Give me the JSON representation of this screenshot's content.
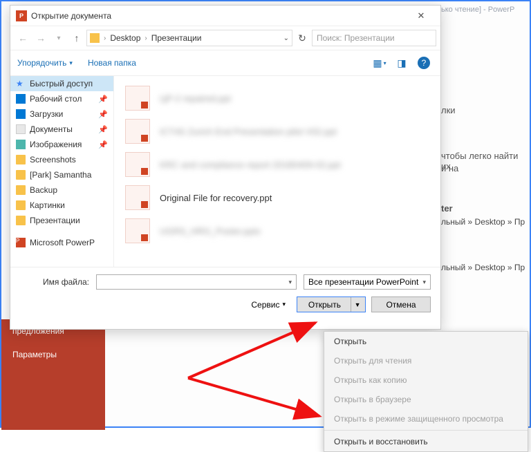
{
  "app_background": {
    "title_fragment": "ько чтение]  -  PowerP",
    "left_menu": {
      "item1": "предложения",
      "item2": "Параметры"
    },
    "right_lines": {
      "l1": "лки",
      "l2": "чтобы легко найти их",
      "l3": "и на",
      "l4": "ter"
    },
    "path_line": "льный » Desktop » Пр"
  },
  "dialog": {
    "title": "Открытие документа",
    "breadcrumb": {
      "seg1": "Desktop",
      "seg2": "Презентации"
    },
    "search_placeholder": "Поиск: Презентации",
    "toolbar": {
      "organize": "Упорядочить",
      "new_folder": "Новая папка"
    },
    "tree": [
      {
        "name": "Быстрый доступ",
        "kind": "star",
        "selected": true
      },
      {
        "name": "Рабочий стол",
        "kind": "desktop",
        "pinned": true
      },
      {
        "name": "Загрузки",
        "kind": "down",
        "pinned": true
      },
      {
        "name": "Документы",
        "kind": "doc",
        "pinned": true
      },
      {
        "name": "Изображения",
        "kind": "img",
        "pinned": true
      },
      {
        "name": "Screenshots",
        "kind": "folder"
      },
      {
        "name": "[Park] Samantha",
        "kind": "folder"
      },
      {
        "name": "Backup",
        "kind": "folder"
      },
      {
        "name": "Картинки",
        "kind": "folder"
      },
      {
        "name": "Презентации",
        "kind": "folder"
      },
      {
        "name": "Microsoft PowerP",
        "kind": "pp"
      }
    ],
    "files": [
      {
        "name": "ЦР-2 repaired.ppt",
        "blur": true
      },
      {
        "name": "ICT4S Zurich End Presentation pilot V02.ppt",
        "blur": true
      },
      {
        "name": "KRC and compliance report 20180409-02.ppt",
        "blur": true
      },
      {
        "name": "Original File for recovery.ppt",
        "blur": false
      },
      {
        "name": "UGRS_HRG_Poster.pptx",
        "blur": true
      }
    ],
    "footer": {
      "filename_label": "Имя файла:",
      "filename_value": "",
      "filter_label": "Все презентации PowerPoint",
      "tools_label": "Сервис",
      "open_label": "Открыть",
      "cancel_label": "Отмена"
    }
  },
  "open_menu": {
    "items": [
      {
        "label": "Открыть",
        "enabled": true
      },
      {
        "label": "Открыть для чтения",
        "enabled": false
      },
      {
        "label": "Открыть как копию",
        "enabled": false
      },
      {
        "label": "Открыть в браузере",
        "enabled": false
      },
      {
        "label": "Открыть в режиме защищенного просмотра",
        "enabled": false
      },
      {
        "label": "Открыть и восстановить",
        "enabled": true
      }
    ]
  }
}
